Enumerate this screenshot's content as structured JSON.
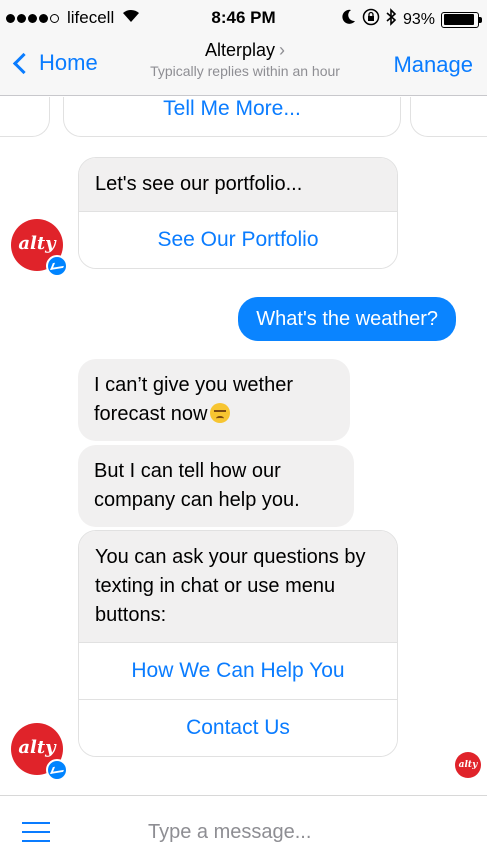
{
  "status_bar": {
    "carrier": "lifecell",
    "time": "8:46 PM",
    "battery": "93%",
    "battery_level": 0.93,
    "signal_icon": "signal-dots-icon",
    "wifi_icon": "wifi-icon",
    "moon_icon": "moon-icon",
    "lock_rotation_icon": "orientation-lock-icon",
    "bluetooth_icon": "bluetooth-icon"
  },
  "nav": {
    "back_label": "Home",
    "title": "Alterplay",
    "title_chevron": "›",
    "subtitle": "Typically replies within an hour",
    "action_label": "Manage"
  },
  "messages": {
    "carousel_button": "Tell Me More...",
    "portfolio": {
      "text": "Let's see our portfolio...",
      "button": "See Our Portfolio"
    },
    "outgoing": "What's the weather?",
    "bot1_text": "I can’t give you wether forecast now",
    "bot1_emoji": "unamused-face-icon",
    "bot2_text": "But I can tell how our company can help you.",
    "menu": {
      "text": "You can ask your questions by texting in chat or use menu buttons:",
      "buttons": [
        "How We Can Help You",
        "Contact Us"
      ]
    },
    "avatar_label": "alty",
    "read_receipt_label": "alty"
  },
  "composer": {
    "placeholder": "Type a message...",
    "value": "",
    "menu_icon": "hamburger-menu-icon"
  },
  "colors": {
    "accent": "#0a7cff",
    "outgoing_bubble": "#0a84ff",
    "incoming_bubble": "#f1f0f0",
    "brand_red": "#e0232a"
  }
}
